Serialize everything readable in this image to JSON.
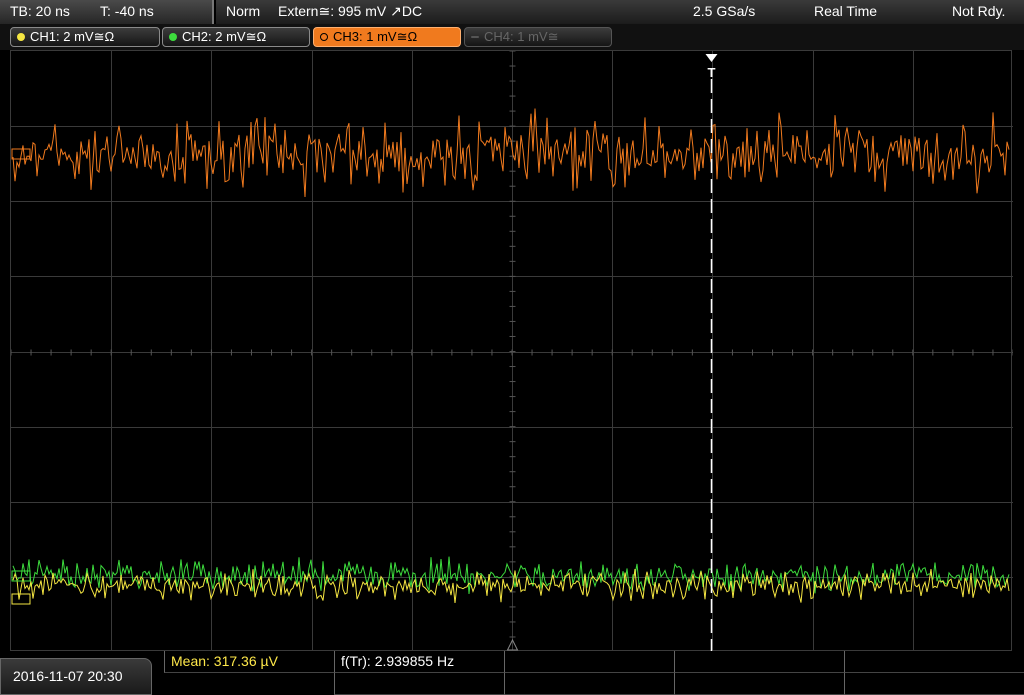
{
  "header": {
    "timebase": "TB: 20 ns",
    "trigger_time": "T: -40 ns",
    "trigger_mode": "Norm",
    "trigger_source": "Extern≅: 995 mV ↗DC",
    "sample_rate": "2.5 GSa/s",
    "acq_mode": "Real Time",
    "status": "Not Rdy."
  },
  "channels": [
    {
      "label": "CH1: 2 mV≅Ω",
      "color": "#f5e642",
      "active": false,
      "enabled": true
    },
    {
      "label": "CH2: 2 mV≅Ω",
      "color": "#3ddc3d",
      "active": false,
      "enabled": true
    },
    {
      "label": "CH3: 1 mV≅Ω",
      "color": "#f07a1e",
      "active": true,
      "enabled": true
    },
    {
      "label": "CH4: 1 mV≅",
      "color": "#555555",
      "active": false,
      "enabled": false
    }
  ],
  "markers": {
    "trigger_label": "T"
  },
  "footer": {
    "datetime": "2016-11-07 20:30",
    "mean": "Mean: 317.36 µV",
    "freq": "f(Tr): 2.939855 Hz"
  },
  "colors": {
    "ch1": "#f5e642",
    "ch2": "#3ddc3d",
    "ch3": "#f07a1e",
    "grid": "#3a3a3a",
    "meas_text": "#ffe94a"
  }
}
